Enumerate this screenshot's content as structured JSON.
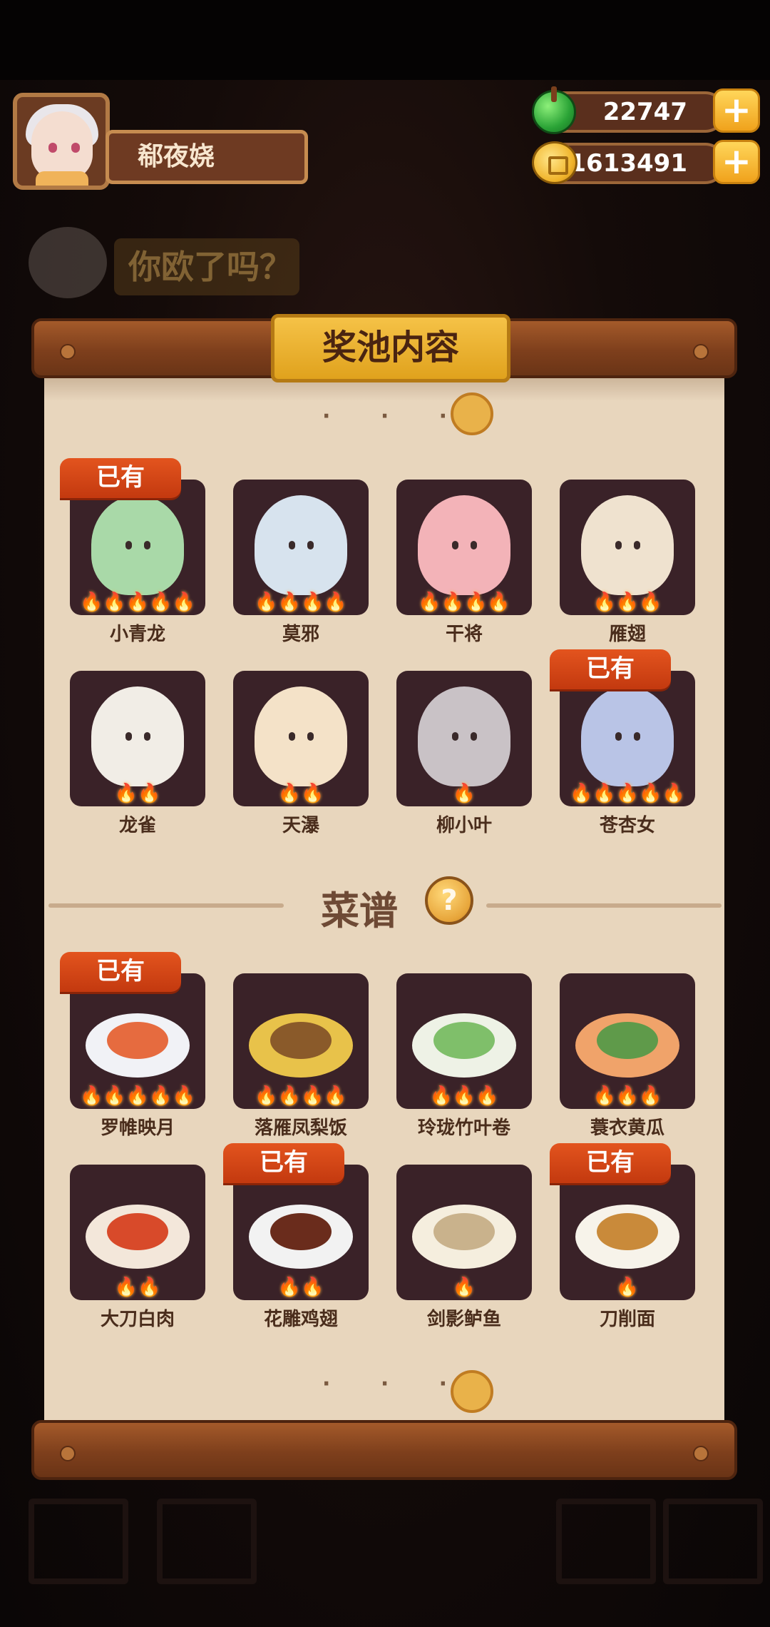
{
  "player": {
    "name": "郗夜娆"
  },
  "resources": {
    "gems": "22747",
    "coins": "51613491"
  },
  "background": {
    "banner_text": "你欧了吗？"
  },
  "panel": {
    "title": "奖池内容",
    "characters": [
      {
        "name": "小青龙",
        "stars": 5,
        "owned": true
      },
      {
        "name": "莫邪",
        "stars": 4,
        "owned": false
      },
      {
        "name": "干将",
        "stars": 4,
        "owned": false
      },
      {
        "name": "雁翅",
        "stars": 3,
        "owned": false
      },
      {
        "name": "龙雀",
        "stars": 2,
        "owned": false
      },
      {
        "name": "天瀑",
        "stars": 2,
        "owned": false
      },
      {
        "name": "柳小叶",
        "stars": 1,
        "owned": false
      },
      {
        "name": "苍杏女",
        "stars": 5,
        "owned": true
      }
    ],
    "recipes_section": {
      "title": "菜谱",
      "help_symbol": "?"
    },
    "recipes": [
      {
        "name": "罗帷映月",
        "stars": 5,
        "owned": true
      },
      {
        "name": "落雁凤梨饭",
        "stars": 4,
        "owned": false
      },
      {
        "name": "玲珑竹叶卷",
        "stars": 3,
        "owned": false
      },
      {
        "name": "蓑衣黄瓜",
        "stars": 3,
        "owned": false
      },
      {
        "name": "大刀白肉",
        "stars": 2,
        "owned": false
      },
      {
        "name": "花雕鸡翅",
        "stars": 2,
        "owned": true
      },
      {
        "name": "剑影鲈鱼",
        "stars": 1,
        "owned": false
      },
      {
        "name": "刀削面",
        "stars": 1,
        "owned": true
      }
    ],
    "owned_label": "已有",
    "flame_glyph": "🔥"
  },
  "colors": {
    "owned_tag": "#d8471a",
    "card_bg": "#3a2228",
    "parchment": "#e8d6bd",
    "title_gold": "#f0b42b"
  }
}
